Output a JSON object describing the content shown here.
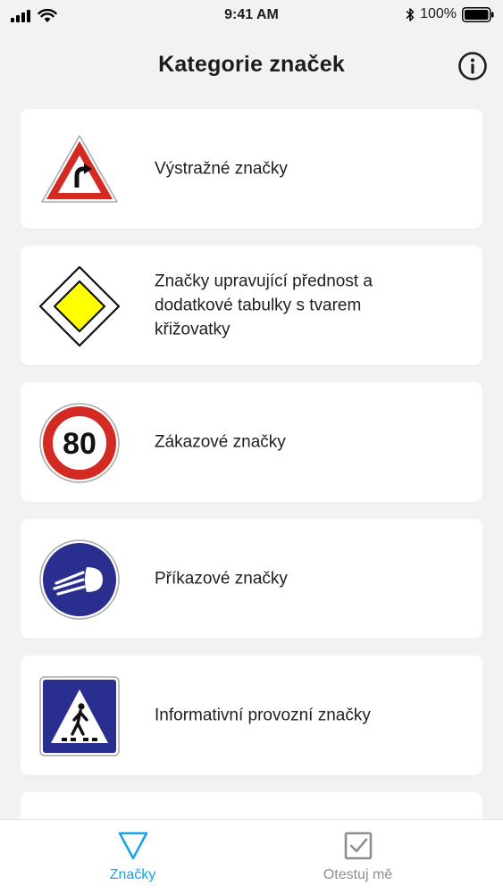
{
  "status_bar": {
    "time": "9:41 AM",
    "battery": "100%"
  },
  "header": {
    "title": "Kategorie značek"
  },
  "categories": [
    {
      "label": "Výstražné značky",
      "icon": "warning-triangle-curve-icon"
    },
    {
      "label": "Značky upravující přednost a dodatkové tabulky s tvarem křižovatky",
      "icon": "priority-road-diamond-icon"
    },
    {
      "label": "Zákazové značky",
      "icon": "speed-limit-80-icon"
    },
    {
      "label": "Příkazové značky",
      "icon": "headlights-mandatory-icon"
    },
    {
      "label": "Informativní provozní značky",
      "icon": "pedestrian-crossing-icon"
    }
  ],
  "speed_limit_text": "80",
  "tabs": [
    {
      "label": "Značky",
      "icon": "triangle-outline-icon",
      "active": true
    },
    {
      "label": "Otestuj mě",
      "icon": "checkbox-icon",
      "active": false
    }
  ],
  "colors": {
    "accent": "#1aa3e8",
    "inactive_tab": "#8e8e93",
    "background": "#f2f2f4",
    "sign_red": "#d42a24",
    "sign_blue": "#2a2f8f",
    "sign_yellow": "#ffff00"
  }
}
